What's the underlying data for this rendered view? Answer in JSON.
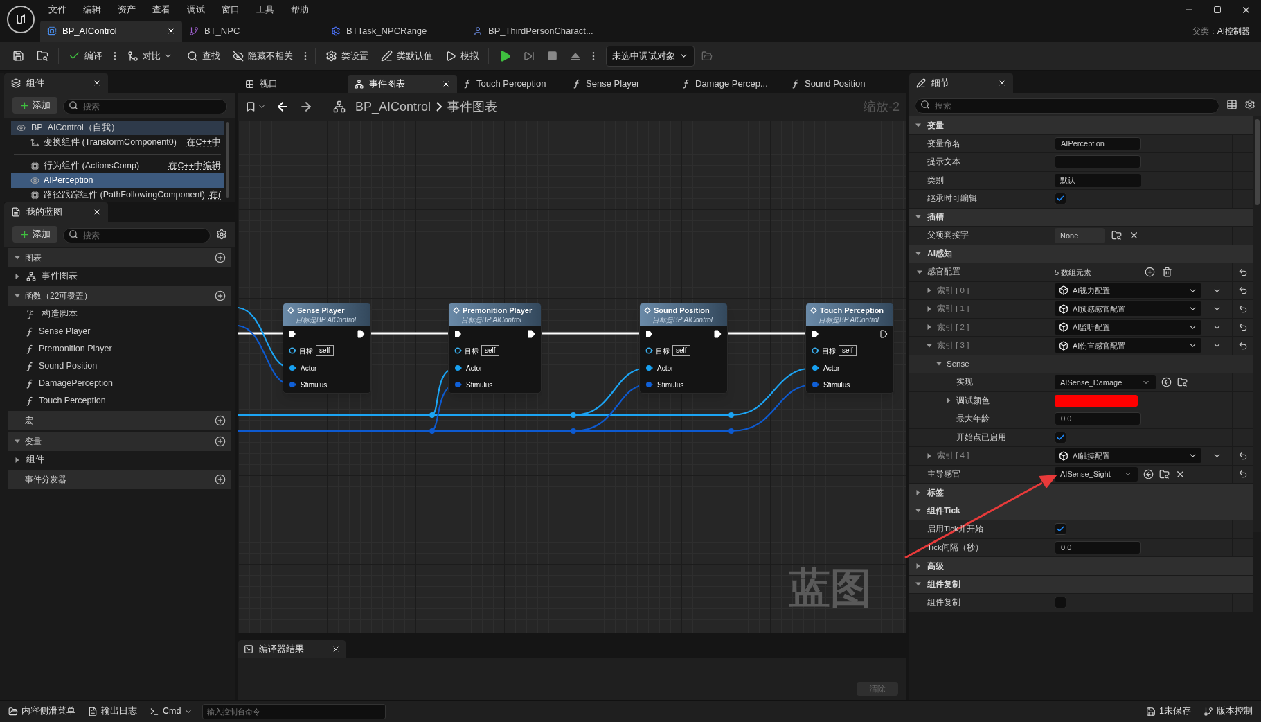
{
  "menu": [
    "文件",
    "编辑",
    "资产",
    "查看",
    "调试",
    "窗口",
    "工具",
    "帮助"
  ],
  "document_tabs": [
    {
      "label": "BP_AIControl",
      "kind": "controller",
      "selected": true
    },
    {
      "label": "BT_NPC",
      "kind": "tree",
      "selected": false
    },
    {
      "label": "BTTask_NPCRange",
      "kind": "task",
      "selected": false
    },
    {
      "label": "BP_ThirdPersonCharact...",
      "kind": "character",
      "selected": false
    }
  ],
  "parent_class": {
    "label": "父类：",
    "value": "AI控制器"
  },
  "toolbar": {
    "compile": "编译",
    "diff": "对比",
    "find": "查找",
    "hide_unrelated": "隐藏不相关",
    "class_settings": "类设置",
    "class_defaults": "类默认值",
    "simulate": "模拟",
    "debug_target": "未选中调试对象"
  },
  "components_panel": {
    "title": "组件",
    "add": "添加",
    "search_placeholder": "搜索",
    "root": {
      "label": "BP_AIControl（自我）",
      "children": [
        {
          "label": "变换组件 (TransformComponent0)",
          "link": "在C++中",
          "kind": "transform",
          "selected": false
        },
        {
          "label": "行为组件 (ActionsComp)",
          "link": "在C++中编辑",
          "kind": "component",
          "selected": false
        },
        {
          "label": "AIPerception",
          "kind": "perception",
          "selected": true
        },
        {
          "label": "路径跟踪组件 (PathFollowingComponent)",
          "link": "在(",
          "kind": "component",
          "selected": false
        }
      ]
    }
  },
  "my_blueprint": {
    "title": "我的蓝图",
    "add": "添加",
    "search_placeholder": "搜索",
    "sections": [
      {
        "title": "图表",
        "expanded": true,
        "items": [
          {
            "label": "事件图表",
            "kind": "graph",
            "expanded": false
          }
        ]
      },
      {
        "title": "函数（22可覆盖）",
        "expanded": true,
        "items": [
          {
            "label": "构造脚本",
            "kind": "construct"
          },
          {
            "label": "Sense Player",
            "kind": "function"
          },
          {
            "label": "Premonition Player",
            "kind": "function"
          },
          {
            "label": "Sound Position",
            "kind": "function"
          },
          {
            "label": "DamagePerception",
            "kind": "function"
          },
          {
            "label": "Touch Perception",
            "kind": "function"
          }
        ]
      },
      {
        "title": "宏"
      },
      {
        "title": "变量",
        "expanded": true,
        "items": [
          {
            "label": "组件",
            "kind": "category",
            "expanded": false
          }
        ]
      },
      {
        "title": "事件分发器"
      }
    ]
  },
  "graph_tabs": [
    {
      "label": "视口",
      "kind": "viewport",
      "selected": false
    },
    {
      "label": "事件图表",
      "kind": "graph",
      "selected": true
    },
    {
      "label": "Touch Perception",
      "kind": "function",
      "selected": false
    },
    {
      "label": "Sense Player",
      "kind": "function",
      "selected": false
    },
    {
      "label": "Damage Percep...",
      "kind": "function",
      "selected": false
    },
    {
      "label": "Sound Position",
      "kind": "function",
      "selected": false
    }
  ],
  "breadcrumb": [
    "BP_AIControl",
    "事件图表"
  ],
  "zoom": "缩放-2",
  "graph_watermark": "蓝图",
  "nodes": [
    {
      "title": "Sense Player",
      "subtitle": "目标是BP AIControl",
      "target_label": "目标",
      "target_value": "self",
      "pins": [
        "Actor",
        "Stimulus"
      ],
      "exec_out_connected": true
    },
    {
      "title": "Premonition Player",
      "subtitle": "目标是BP AIControl",
      "target_label": "目标",
      "target_value": "self",
      "pins": [
        "Actor",
        "Stimulus"
      ],
      "exec_out_connected": true
    },
    {
      "title": "Sound Position",
      "subtitle": "目标是BP AIControl",
      "target_label": "目标",
      "target_value": "self",
      "pins": [
        "Actor",
        "Stimulus"
      ],
      "exec_out_connected": true
    },
    {
      "title": "Touch Perception",
      "subtitle": "目标是BP AIControl",
      "target_label": "目标",
      "target_value": "self",
      "pins": [
        "Actor",
        "Stimulus"
      ],
      "exec_out_connected": false
    }
  ],
  "compiler_results": {
    "title": "编译器结果",
    "clear": "清除"
  },
  "details": {
    "title": "细节",
    "search_placeholder": "搜索",
    "sections": [
      {
        "title": "变量",
        "expanded": true,
        "rows": [
          {
            "kind": "text",
            "label": "变量命名",
            "value": "AIPerception"
          },
          {
            "kind": "text",
            "label": "提示文本"
          },
          {
            "kind": "dropdown",
            "label": "类别",
            "value": "默认"
          },
          {
            "kind": "checkbox",
            "label": "继承时可编辑",
            "checked": true
          }
        ]
      },
      {
        "title": "插槽",
        "expanded": true,
        "rows": [
          {
            "kind": "object",
            "label": "父项套接字",
            "value": "None"
          }
        ]
      },
      {
        "title": "AI感知",
        "expanded": true,
        "rows": [
          {
            "kind": "array",
            "label": "感官配置",
            "value": "5 数组元素",
            "expanded": true,
            "children": [
              {
                "kind": "element",
                "label": "索引 [ 0 ]",
                "value": "AI视力配置",
                "expanded": false
              },
              {
                "kind": "element",
                "label": "索引 [ 1 ]",
                "value": "AI预感感官配置",
                "expanded": false
              },
              {
                "kind": "element",
                "label": "索引 [ 2 ]",
                "value": "AI监听配置",
                "expanded": false
              },
              {
                "kind": "element",
                "label": "索引 [ 3 ]",
                "value": "AI伤害感官配置",
                "expanded": true,
                "children": [
                  {
                    "kind": "group",
                    "label": "Sense",
                    "expanded": true,
                    "children": [
                      {
                        "kind": "class",
                        "label": "实现",
                        "value": "AISense_Damage",
                        "clearable": false
                      },
                      {
                        "kind": "color",
                        "label": "调试颜色",
                        "color": "#ff0000",
                        "expanded": false
                      },
                      {
                        "kind": "number",
                        "label": "最大年龄",
                        "value": "0.0"
                      },
                      {
                        "kind": "checkbox",
                        "label": "开始点已启用",
                        "checked": true
                      }
                    ]
                  }
                ]
              },
              {
                "kind": "element",
                "label": "索引 [ 4 ]",
                "value": "AI触摸配置",
                "expanded": false
              }
            ]
          },
          {
            "kind": "class",
            "label": "主导感官",
            "value": "AISense_Sight",
            "clearable": true
          }
        ]
      },
      {
        "title": "标签",
        "expanded": false
      },
      {
        "title": "组件Tick",
        "expanded": true,
        "rows": [
          {
            "kind": "checkbox",
            "label": "启用Tick并开始",
            "checked": true
          },
          {
            "kind": "number",
            "label": "Tick间隔（秒）",
            "value": "0.0"
          }
        ]
      },
      {
        "title": "高级",
        "expanded": false
      },
      {
        "title": "组件复制",
        "expanded": true,
        "rows": [
          {
            "kind": "checkbox",
            "label": "组件复制",
            "checked": false
          }
        ]
      }
    ]
  },
  "status_bar": {
    "content_drawer": "内容侧滑菜单",
    "output_log": "输出日志",
    "cmd": "Cmd",
    "console_placeholder": "输入控制台命令",
    "unsaved": "1未保存",
    "source_control": "版本控制"
  }
}
